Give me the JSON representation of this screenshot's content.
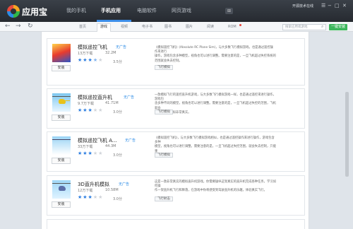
{
  "app": {
    "name": "应用宝"
  },
  "nav": {
    "tabs": [
      "我的手机",
      "手机应用",
      "电脑软件",
      "网页游戏"
    ],
    "active_index": 1
  },
  "window": {
    "user": "开源技术在线",
    "controls": [
      "☰",
      "−",
      "□",
      "✕"
    ]
  },
  "toolbar": {
    "categories": [
      "首页",
      "游戏",
      "视频",
      "电子书",
      "图书",
      "图片",
      "阅读",
      "ROM"
    ],
    "active": "游戏",
    "search_placeholder": "搜索应用或游戏",
    "install_label": "一键安装"
  },
  "apps": [
    {
      "name": "模拟遥控飞机",
      "ad": "无广告",
      "downloads": "13万下载",
      "size": "32.2M",
      "stars": 3.5,
      "rating": "3.5分",
      "install": "安装",
      "desc": "《模拟遥控飞机》(Absolute RC Plane Sim)，与大多数飞行模拟游戏，也是通过遥控操作来进行\n操作，游戏包含多种模型，视角也可以进行调整。需要注意的是，一旦飞机超过失控系统的\n范围就会失去控制。",
      "tag": "飞行模拟"
    },
    {
      "name": "模拟遥控直升机",
      "ad": "无广告",
      "downloads": "9.7万下载",
      "size": "41.71M",
      "stars": 3.0,
      "rating": "3.0分",
      "install": "安装",
      "desc": "一款模拟飞行的遥控直升机游戏，与大多数飞行模拟游戏一样，也是通过遥控来进行操作，游戏包\n含多种不同的模型，视角也可以进行调整。需要注意的是，一旦飞机超过失控的范围，飞机就会\n失去控制，模拟非常真实。",
      "tag": "飞行模拟"
    },
    {
      "name": "模拟遥控飞机 A...",
      "ad": "无广告",
      "downloads": "33万下载",
      "size": "44.3M",
      "stars": 3.0,
      "rating": "3.0分",
      "install": "安装",
      "desc": "《模拟遥控飞机》，与大多数飞行模拟游戏相似，也是通过遥控操作来进行操作，游戏包含多种\n模型，视角也可以进行调整。需要注意的是，一旦飞机超过失控范围，就会失去控制，只能重\n新开始。",
      "tag": "飞行模拟"
    },
    {
      "name": "3D直升机模拟",
      "ad": "无广告",
      "downloads": "12万下载",
      "size": "10.58M",
      "stars": 3.0,
      "rating": "3.0分",
      "install": "安装",
      "desc": "这是一款非常真实的模拟直升机游戏，你需要操纵这架真实的直升机完成各种任务，学习如何操\n作一架直升机飞行和降落，在游戏中你将感受到驾驶直升机的乐趣，体验真实飞行。",
      "tag": "飞行射击"
    }
  ]
}
